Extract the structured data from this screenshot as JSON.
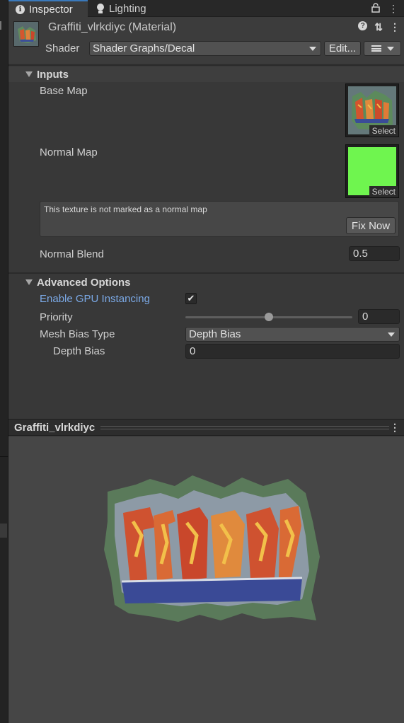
{
  "tabs": [
    {
      "label": "Inspector",
      "icon": "info-icon",
      "active": true
    },
    {
      "label": "Lighting",
      "icon": "bulb-icon",
      "active": false
    }
  ],
  "tab_tools": {
    "lock": "🔒",
    "more": "⋮"
  },
  "header": {
    "title": "Graffiti_vlrkdiyc (Material)",
    "shader_label": "Shader",
    "shader_value": "Shader Graphs/Decal",
    "edit_label": "Edit...",
    "help_icon": "?",
    "preset_icon": "⇅",
    "more_icon": "⋮"
  },
  "inputs": {
    "section_title": "Inputs",
    "base_map_label": "Base Map",
    "normal_map_label": "Normal Map",
    "select_label": "Select",
    "help_message": "This texture is not marked as a normal map",
    "fix_now_label": "Fix Now",
    "normal_blend_label": "Normal Blend",
    "normal_blend_value": "0.5"
  },
  "advanced": {
    "section_title": "Advanced Options",
    "gpu_instancing_label": "Enable GPU Instancing",
    "gpu_instancing_checked": true,
    "priority_label": "Priority",
    "priority_value": "0",
    "priority_slider_fraction": 0.5,
    "mesh_bias_type_label": "Mesh Bias Type",
    "mesh_bias_type_value": "Depth Bias",
    "depth_bias_label": "Depth Bias",
    "depth_bias_value": "0"
  },
  "preview": {
    "title": "Graffiti_vlrkdiyc",
    "more_icon": "⋮"
  },
  "colors": {
    "accent_blue": "#3a79bb",
    "link_text": "#7ba9e6",
    "normal_map_green": "#6ff54f",
    "panel_bg": "#383838",
    "preview_bg": "#464646"
  }
}
